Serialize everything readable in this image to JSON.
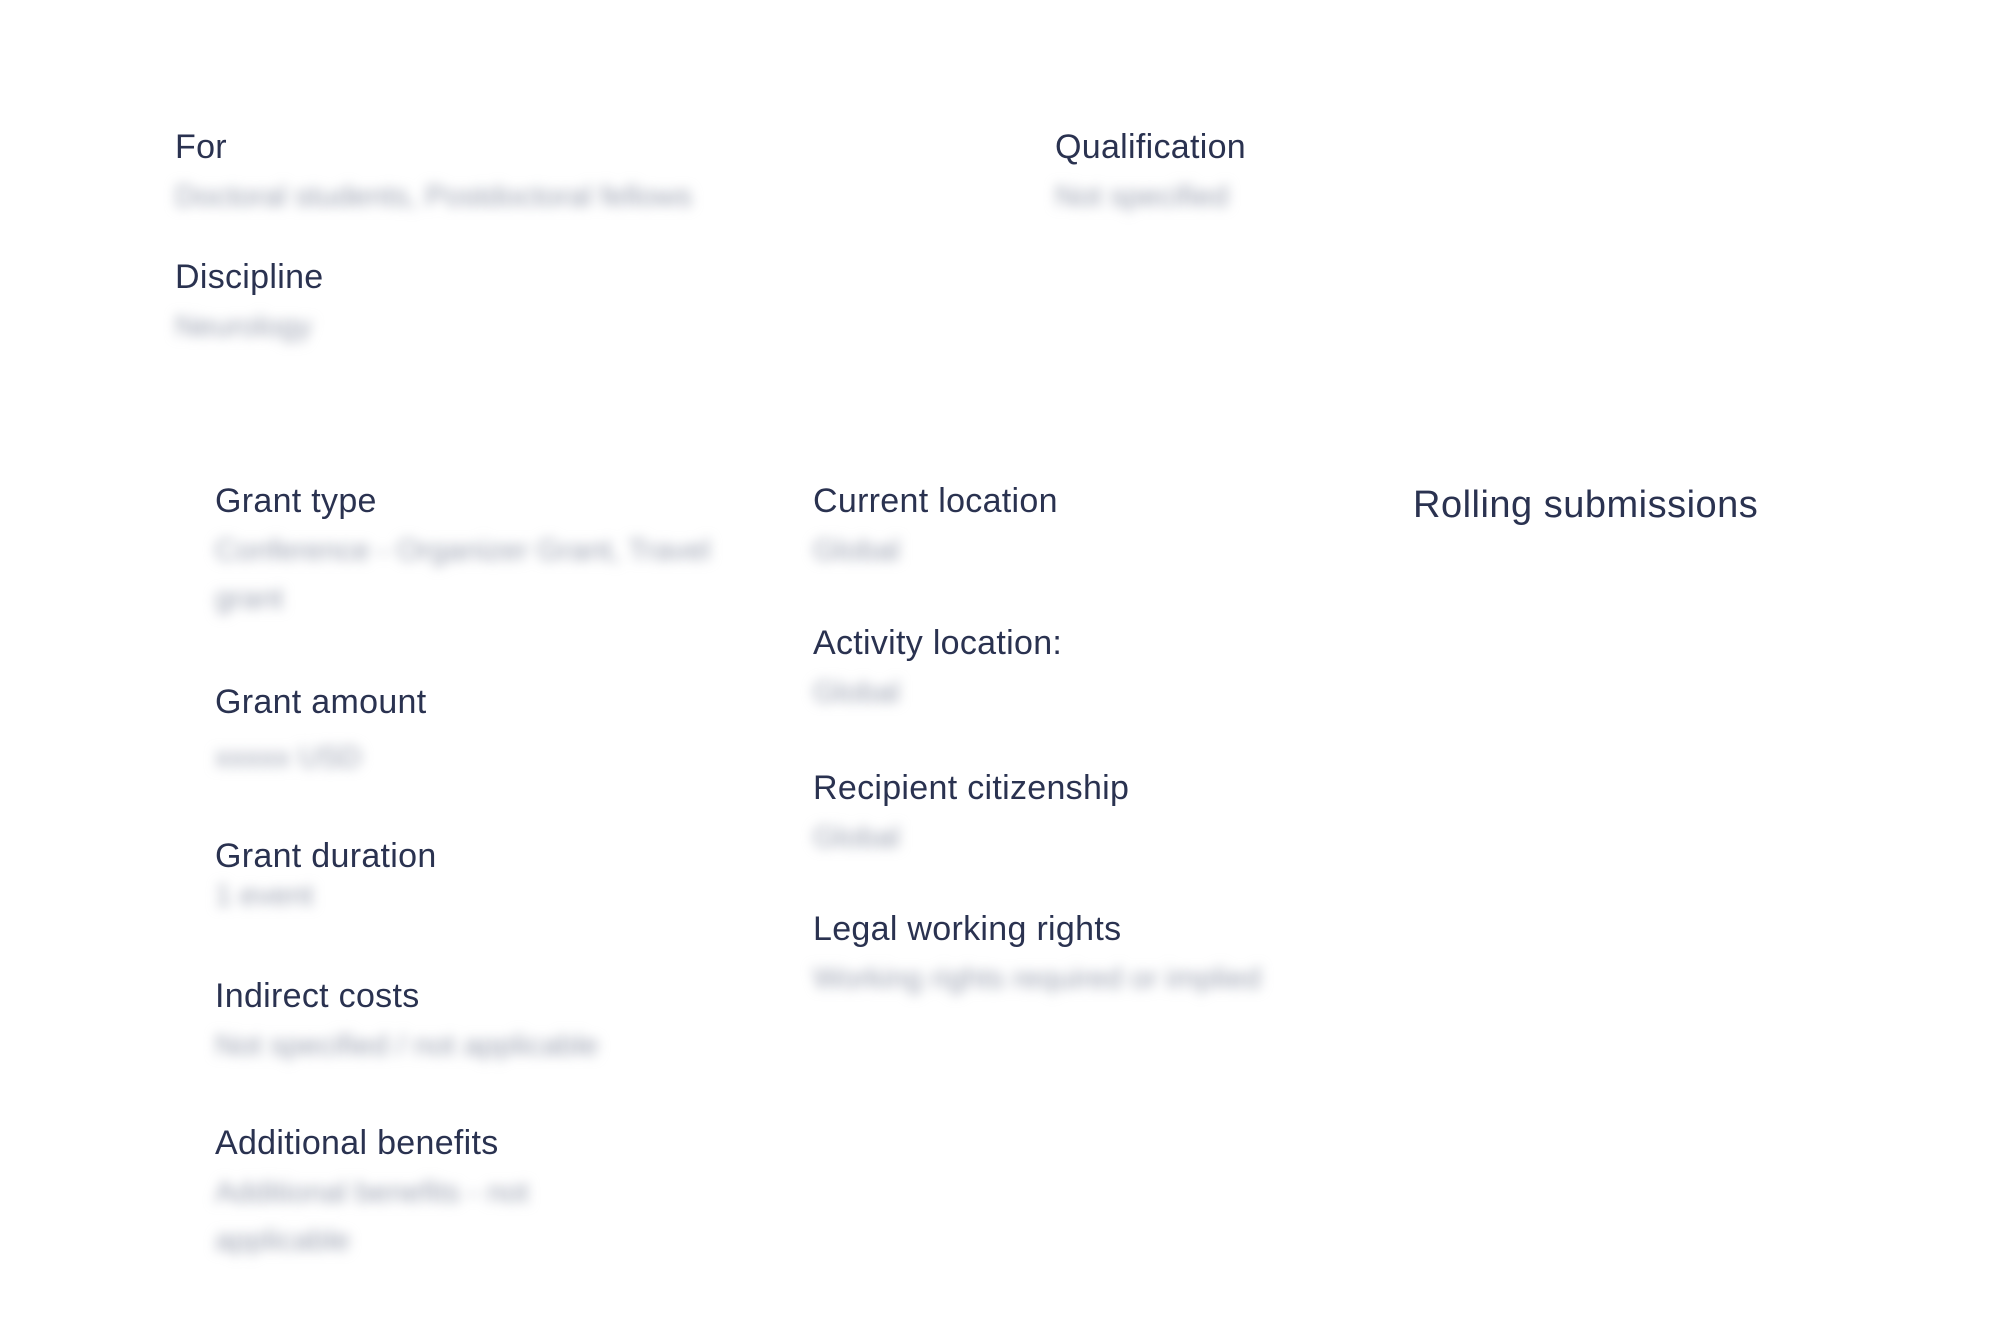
{
  "top": {
    "for_label": "For",
    "for_value": "Doctoral students, Postdoctoral fellows",
    "qualification_label": "Qualification",
    "qualification_value": "Not specified",
    "discipline_label": "Discipline",
    "discipline_value": "Neurology"
  },
  "details_left": {
    "grant_type_label": "Grant type",
    "grant_type_value": "Conference - Organizer Grant, Travel grant",
    "grant_amount_label": "Grant amount",
    "grant_amount_value": "xxxxx USD",
    "grant_duration_label": "Grant duration",
    "grant_duration_value": "1 event",
    "indirect_costs_label": "Indirect costs",
    "indirect_costs_value": "Not specified / not applicable",
    "additional_benefits_label": "Additional benefits",
    "additional_benefits_value": "Additional benefits - not applicable"
  },
  "details_middle": {
    "current_location_label": "Current location",
    "current_location_value": "Global",
    "activity_location_label": "Activity location:",
    "activity_location_value": "Global",
    "recipient_citizenship_label": "Recipient citizenship",
    "recipient_citizenship_value": "Global",
    "legal_working_rights_label": "Legal working rights",
    "legal_working_rights_value": "Working rights required or implied"
  },
  "details_right": {
    "rolling_label": "Rolling submissions"
  },
  "colors": {
    "label_text": "#2a3250",
    "blurred_value": "#9aa0b0",
    "background": "#ffffff"
  }
}
